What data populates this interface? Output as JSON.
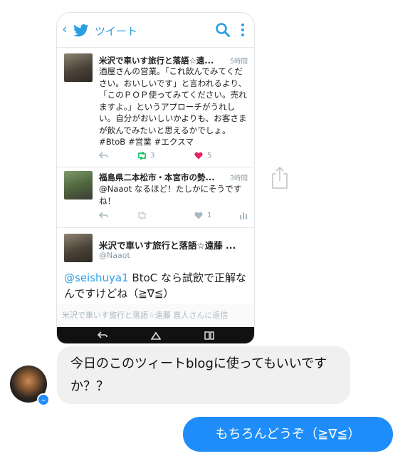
{
  "twitter": {
    "header_title": "ツイート",
    "tweets": [
      {
        "name": "米沢で車いす旅行と落語☆遠...",
        "time": "5時間",
        "body": "酒屋さんの営業。「これ飲んでみてください。おいしいです」と言われるより、「このＰＯＰ使ってみてください。売れますよ。」というアプローチがうれしい。自分がおいしいかよりも、お客さまが飲んでみたいと思えるかでしょ。#BtoB #営業 #エクスマ",
        "retweets": "3",
        "likes": "5"
      },
      {
        "name": "福島県二本松市・本宮市の勢...",
        "time": "3時間",
        "mention": "@Naaot",
        "body": " なるほど！たしかにそうですね！",
        "likes": "1"
      },
      {
        "name": "米沢で車いす旅行と落語☆遠藤 ...",
        "handle": "@Naaot",
        "mention": "@seishuya1",
        "body": " BtoC なら試飲で正解なんですけどね（≧∇≦）"
      }
    ],
    "reply_placeholder": "米沢で車いす旅行と落語☆遠藤 直人さんに返信"
  },
  "messenger": {
    "incoming_message": "今日のこのツィートblogに使ってもいいですか？？",
    "outgoing_message": "もちろんどうぞ（≧∇≦）"
  },
  "colors": {
    "twitter_blue": "#2b9fe6",
    "retweet_green": "#17bf63",
    "like_red": "#e0245e",
    "messenger_blue": "#1e8df9",
    "incoming_bubble": "#f1f0f0"
  },
  "icons": [
    "back-arrow-icon",
    "twitter-bird-icon",
    "search-icon",
    "more-vertical-icon",
    "reply-icon",
    "retweet-icon",
    "heart-icon",
    "analytics-icon",
    "share-icon",
    "messenger-badge-icon",
    "nav-back-icon",
    "nav-home-icon",
    "nav-recents-icon"
  ]
}
